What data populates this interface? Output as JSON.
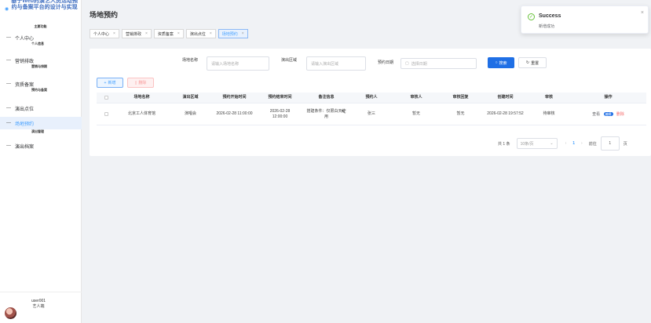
{
  "sidebar": {
    "brand_title": "基于Web的演艺人员活动预约与备案平台的设计与实现",
    "brand_sub": "主要功能",
    "items": [
      {
        "label": "个人中心",
        "sub": "个人信息"
      },
      {
        "label": "营销排政",
        "sub": "营销与排期"
      },
      {
        "label": "资质备案",
        "sub": "预约与备案"
      },
      {
        "label": "演出点位",
        "sub": ""
      },
      {
        "label": "场地预约",
        "sub": "演出管理"
      },
      {
        "label": "演出档案",
        "sub": ""
      }
    ],
    "user_name": "user001",
    "user_role": "艺人端"
  },
  "main": {
    "page_title": "场地预约",
    "tags": [
      "个人中心",
      "营销排政",
      "资质备案",
      "演出点位",
      "场地预约"
    ]
  },
  "search": {
    "venue_label": "场地名称",
    "venue_placeholder": "请输入场地名称",
    "region_label": "演出区域",
    "region_placeholder": "请输入演出区域",
    "date_label": "预约日期",
    "date_placeholder": "选择日期",
    "search_button": "搜索",
    "reset_button": "重置"
  },
  "toolbar": {
    "add_button": "新增",
    "delete_button": "删除"
  },
  "table": {
    "columns": [
      "场地名称",
      "演出区域",
      "预约开始时间",
      "预约结束时间",
      "备注信息",
      "预约人",
      "审核人",
      "审核回复",
      "创建时间",
      "审核",
      "操作"
    ],
    "rows": [
      {
        "venue": "北京工人体育馆",
        "region": "演唱会",
        "start_time": "2026-02-28 11:00:00",
        "end_time": "2026-02-28 12:00:00",
        "remark": "搭建条件：仅限白天使用",
        "booker": "张三",
        "reviewer": "暂无",
        "reply": "暂无",
        "created": "2026-02-28 19:57:52",
        "status": "待审核",
        "view": "查看",
        "edit": "编辑",
        "delete": "删除"
      }
    ]
  },
  "pagination": {
    "total": "共 1 条",
    "page_size": "10条/页",
    "current_page": "1",
    "goto_label": "前往",
    "goto_value": "1",
    "page_unit": "页"
  },
  "toast": {
    "title": "Success",
    "message": "新增成功"
  }
}
